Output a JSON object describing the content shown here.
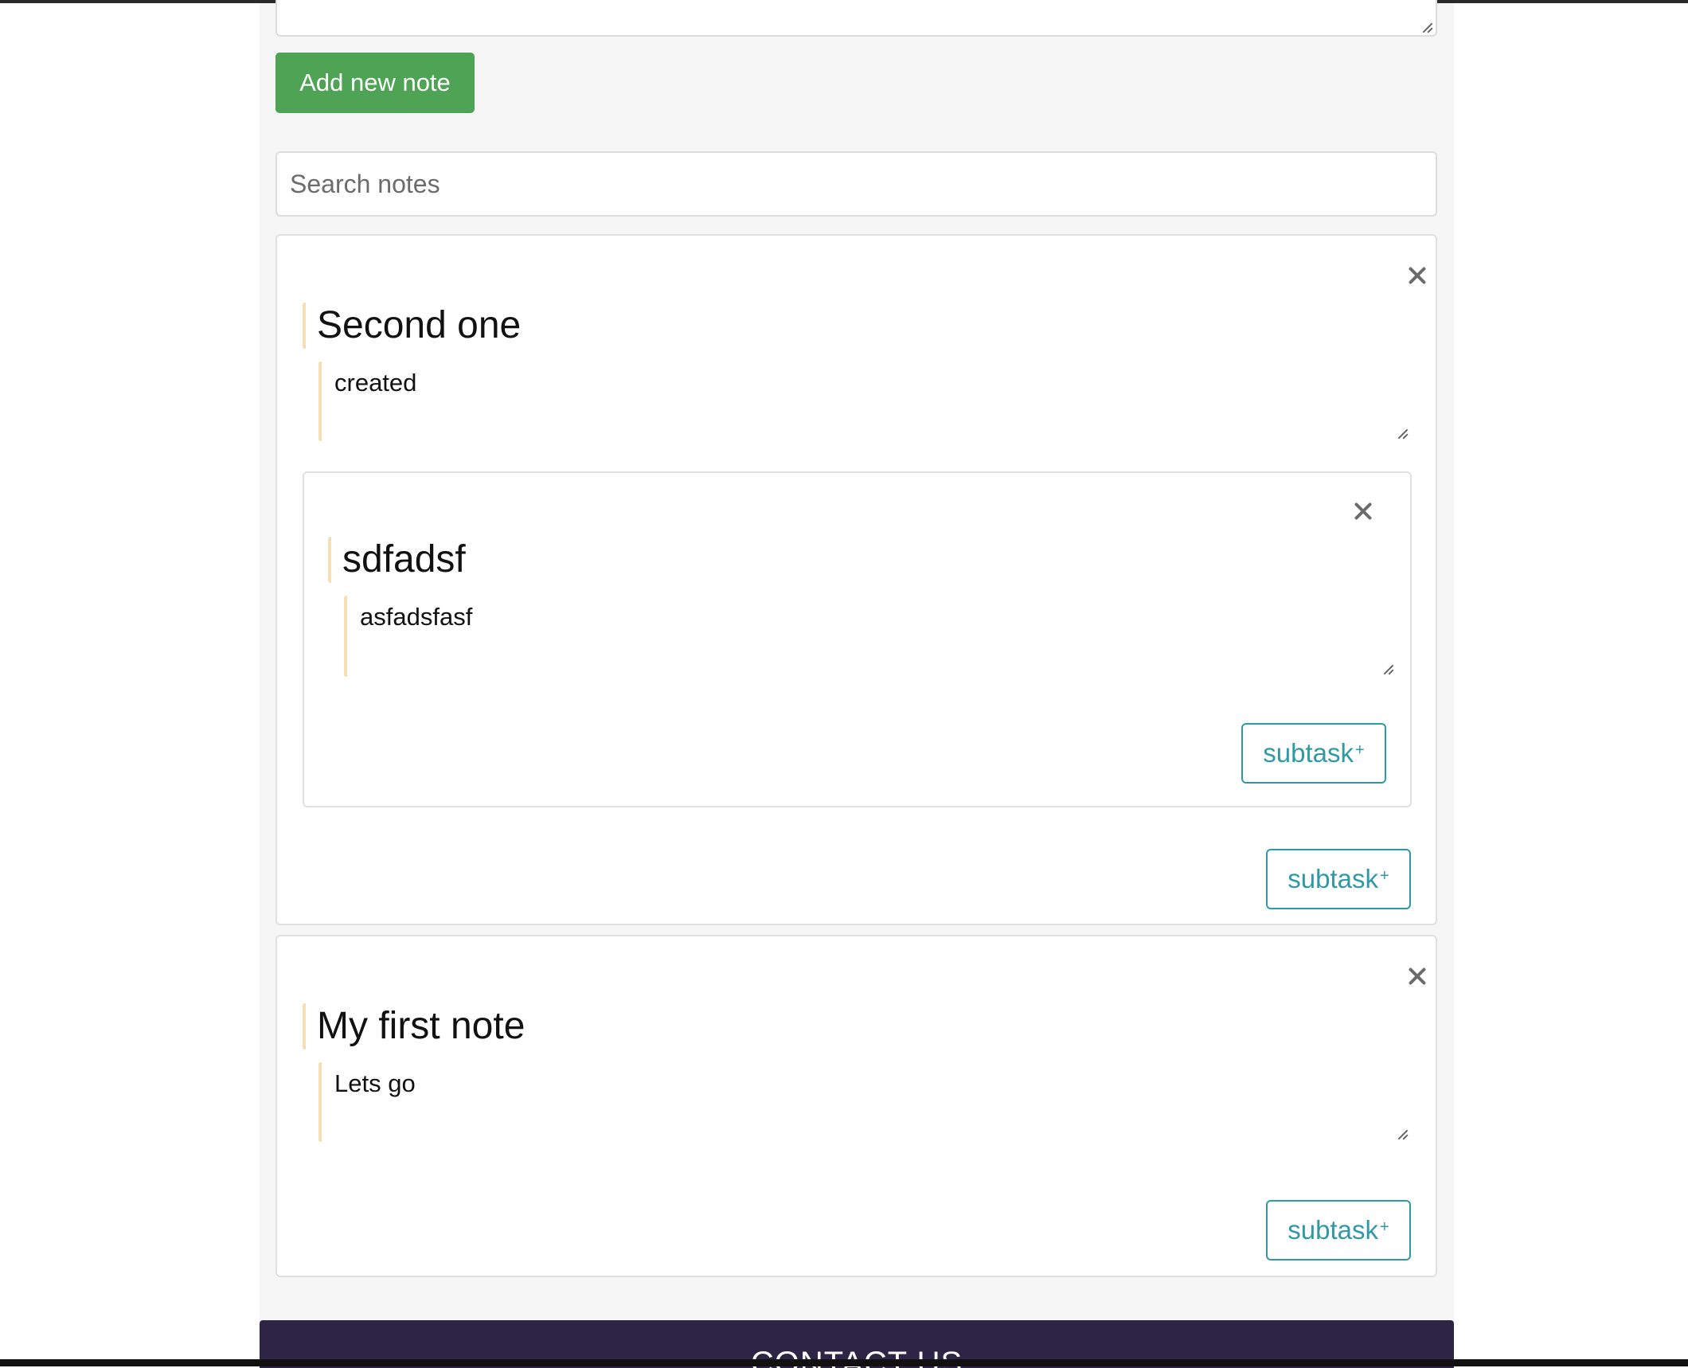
{
  "composer": {
    "add_button_label": "Add new note",
    "search_placeholder": "Search notes"
  },
  "notes": [
    {
      "title": "Second one",
      "body": "created",
      "subtask_label": "subtask",
      "subtask_symbol": "+",
      "subtasks": [
        {
          "title": "sdfadsf",
          "body": "asfadsfasf",
          "subtask_label": "subtask",
          "subtask_symbol": "+"
        }
      ]
    },
    {
      "title": "My first note",
      "body": "Lets go",
      "subtask_label": "subtask",
      "subtask_symbol": "+"
    }
  ],
  "footer": {
    "title": "CONTACT US"
  },
  "colors": {
    "add_button": "#4ea354",
    "subtask_accent": "#2f9aa6",
    "title_border": "#f3dfb4",
    "footer_bg": "#2e2446",
    "content_bg": "#f6f6f7"
  },
  "icons": [
    "close-icon",
    "resize-grip-icon"
  ]
}
